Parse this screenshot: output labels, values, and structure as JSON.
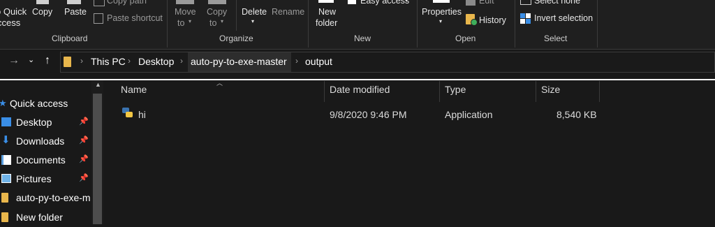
{
  "ribbon": {
    "clipboard": {
      "pin_quick_label": "o Quick",
      "pin_quick_label_2": "ccess",
      "copy_label": "Copy",
      "paste_label": "Paste",
      "copy_path_label": "Copy path",
      "paste_shortcut_label": "Paste shortcut",
      "group_label": "Clipboard"
    },
    "organize": {
      "move_to_label": "Move",
      "move_to_label_2": "to",
      "copy_to_label": "Copy",
      "copy_to_label_2": "to",
      "delete_label": "Delete",
      "rename_label": "Rename",
      "group_label": "Organize"
    },
    "new": {
      "new_folder_label": "New",
      "new_folder_label_2": "folder",
      "easy_access_label": "Easy access",
      "group_label": "New"
    },
    "open": {
      "properties_label": "Properties",
      "edit_label": "Edit",
      "history_label": "History",
      "group_label": "Open"
    },
    "select": {
      "select_none_label": "Select none",
      "invert_selection_label": "Invert selection",
      "group_label": "Select"
    }
  },
  "address": {
    "breadcrumbs": [
      "This PC",
      "Desktop",
      "auto-py-to-exe-master",
      "output"
    ]
  },
  "nav": {
    "items": [
      {
        "label": "Quick access",
        "icon": "star-icon",
        "pinned": false
      },
      {
        "label": "Desktop",
        "icon": "desktop-icon",
        "pinned": true
      },
      {
        "label": "Downloads",
        "icon": "download-icon",
        "pinned": true
      },
      {
        "label": "Documents",
        "icon": "documents-icon",
        "pinned": true
      },
      {
        "label": "Pictures",
        "icon": "pictures-icon",
        "pinned": true
      },
      {
        "label": "auto-py-to-exe-m",
        "icon": "folder-icon",
        "pinned": false
      },
      {
        "label": "New folder",
        "icon": "folder-icon",
        "pinned": false
      }
    ]
  },
  "columns": {
    "name": "Name",
    "date_modified": "Date modified",
    "type": "Type",
    "size": "Size"
  },
  "files": [
    {
      "name": "hi",
      "date_modified": "9/8/2020 9:46 PM",
      "type": "Application",
      "size": "8,540 KB",
      "icon": "python-app-icon"
    }
  ],
  "colors": {
    "background": "#191919",
    "accent_blue": "#3a8ee6",
    "folder_yellow": "#e8b64c"
  }
}
